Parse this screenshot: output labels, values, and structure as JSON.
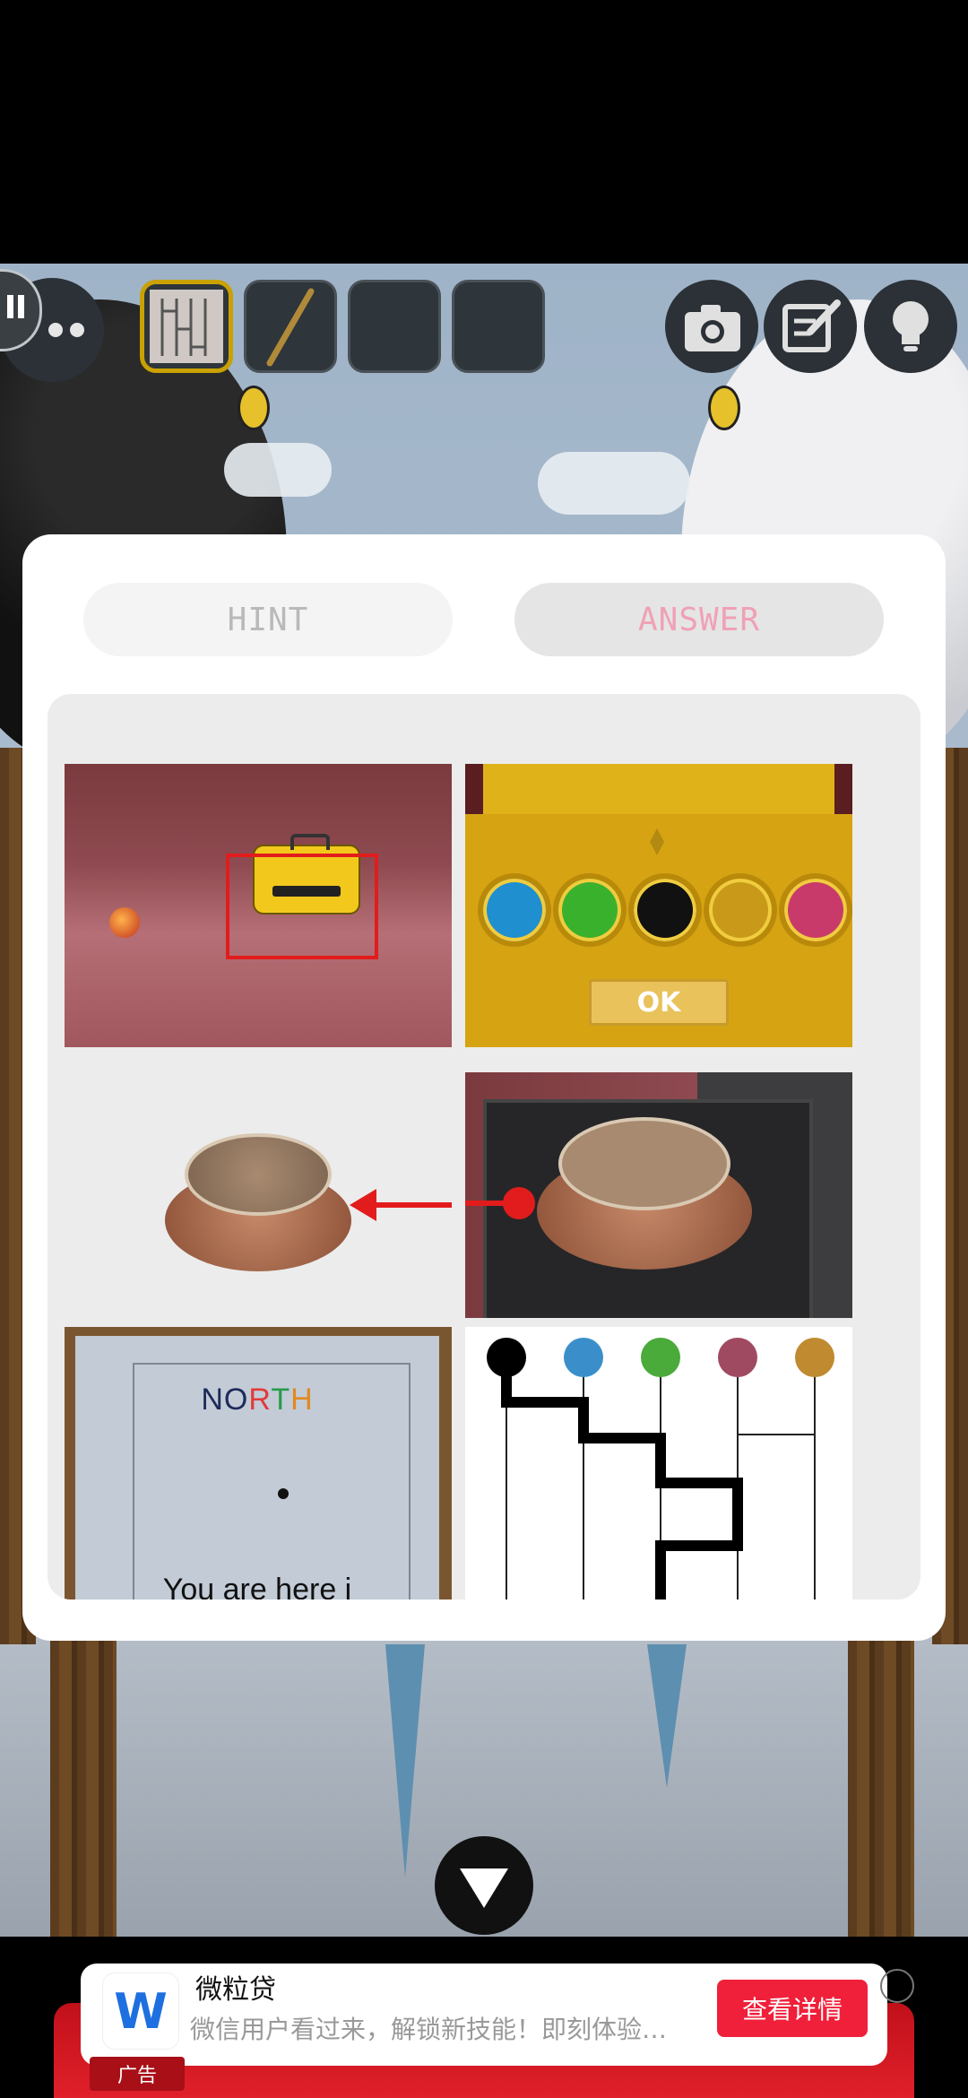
{
  "modal": {
    "tabs": [
      {
        "label": "HINT",
        "active": false
      },
      {
        "label": "ANSWER",
        "active": true
      }
    ]
  },
  "answer_images": {
    "lock_colors": [
      "#1f8fd0",
      "#3ab12d",
      "#111111",
      "#c99a1a",
      "#c83a6a"
    ],
    "ok_label": "OK",
    "map_heading_letters": [
      {
        "ch": "N",
        "color": "#1d2a5a"
      },
      {
        "ch": "O",
        "color": "#1d2a5a"
      },
      {
        "ch": "R",
        "color": "#e23a3a"
      },
      {
        "ch": "T",
        "color": "#2a9a4a"
      },
      {
        "ch": "H",
        "color": "#e08a20"
      }
    ],
    "map_text": "You are here i",
    "path_colors": [
      "#000000",
      "#3a8fca",
      "#4aaa3a",
      "#a04a62",
      "#c08a30"
    ]
  },
  "toolbar": {
    "items": [
      "map-item",
      "stick-item",
      "empty",
      "empty"
    ]
  },
  "ad": {
    "title": "微粒贷",
    "description": "微信用户看过来，解锁新技能！即刻体验…",
    "cta": "查看详情",
    "tag": "广告",
    "logo": "W"
  }
}
